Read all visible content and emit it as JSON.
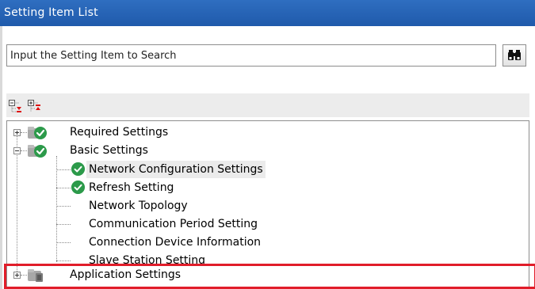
{
  "window": {
    "title": "Setting Item List"
  },
  "search": {
    "placeholder": "Input the Setting Item to Search",
    "value": "",
    "button_icon": "binoculars-icon"
  },
  "toolbar": {
    "buttons": [
      {
        "icon": "expand-all-icon"
      },
      {
        "icon": "collapse-all-icon"
      }
    ]
  },
  "tree": {
    "items": [
      {
        "label": "Required Settings",
        "expanded": false,
        "status": "ok"
      },
      {
        "label": "Basic Settings",
        "expanded": true,
        "status": "ok",
        "children": [
          {
            "label": "Network Configuration Settings",
            "status": "ok",
            "selected": true
          },
          {
            "label": "Refresh Setting",
            "status": "ok"
          },
          {
            "label": "Network Topology",
            "status": "none"
          },
          {
            "label": "Communication Period Setting",
            "status": "none"
          },
          {
            "label": "Connection Device Information",
            "status": "none"
          },
          {
            "label": "Slave Station Setting",
            "status": "none"
          }
        ]
      },
      {
        "label": "Application Settings",
        "expanded": false,
        "status": "unset"
      }
    ]
  },
  "colors": {
    "titlebar": "#2f6ec0",
    "check_green": "#2c9a4a",
    "highlight_red": "#e11d2a"
  }
}
